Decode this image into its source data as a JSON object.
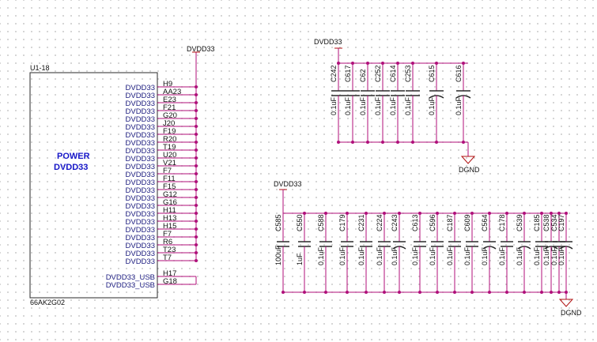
{
  "colors": {
    "wire": "#b00f7a",
    "component": "#2a2a2a",
    "power_symbol": "#b01010",
    "pin_text": "#1e1e82",
    "block_title": "#1616c8"
  },
  "u1": {
    "ref": "U1-18",
    "title_line1": "POWER",
    "title_line2": "DVDD33",
    "part": "66AK2G02",
    "net_top": "DVDD33",
    "pins": [
      {
        "name": "DVDD33",
        "num": "H9"
      },
      {
        "name": "DVDD33",
        "num": "AA23"
      },
      {
        "name": "DVDD33",
        "num": "E23"
      },
      {
        "name": "DVDD33",
        "num": "F21"
      },
      {
        "name": "DVDD33",
        "num": "G20"
      },
      {
        "name": "DVDD33",
        "num": "J20"
      },
      {
        "name": "DVDD33",
        "num": "F19"
      },
      {
        "name": "DVDD33",
        "num": "R20"
      },
      {
        "name": "DVDD33",
        "num": "T19"
      },
      {
        "name": "DVDD33",
        "num": "U20"
      },
      {
        "name": "DVDD33",
        "num": "V21"
      },
      {
        "name": "DVDD33",
        "num": "F7"
      },
      {
        "name": "DVDD33",
        "num": "F11"
      },
      {
        "name": "DVDD33",
        "num": "F15"
      },
      {
        "name": "DVDD33",
        "num": "G12"
      },
      {
        "name": "DVDD33",
        "num": "G16"
      },
      {
        "name": "DVDD33",
        "num": "H11"
      },
      {
        "name": "DVDD33",
        "num": "H13"
      },
      {
        "name": "DVDD33",
        "num": "H15"
      },
      {
        "name": "DVDD33",
        "num": "F7"
      },
      {
        "name": "DVDD33",
        "num": "R6"
      },
      {
        "name": "DVDD33",
        "num": "T23"
      },
      {
        "name": "DVDD33",
        "num": "T7"
      }
    ],
    "usb_pins": [
      {
        "name": "DVDD33_USB",
        "num": "H17"
      },
      {
        "name": "DVDD33_USB",
        "num": "G18"
      }
    ]
  },
  "group1": {
    "power": "DVDD33",
    "ground": "DGND",
    "caps": [
      {
        "ref": "C242",
        "value": "0.1uF",
        "polarized": false
      },
      {
        "ref": "C617",
        "value": "0.1uF",
        "polarized": false
      },
      {
        "ref": "C62",
        "value": "0.1uF",
        "polarized": false
      },
      {
        "ref": "C252",
        "value": "0.1uF",
        "polarized": false
      },
      {
        "ref": "C614",
        "value": "0.1uF",
        "polarized": false
      },
      {
        "ref": "C253",
        "value": "0.1uF",
        "polarized": false
      },
      {
        "ref": "C615",
        "value": "0.1uF",
        "polarized": true
      },
      {
        "ref": "C616",
        "value": "0.1uF",
        "polarized": true
      }
    ]
  },
  "group2": {
    "power": "DVDD33",
    "ground": "DGND",
    "caps": [
      {
        "ref": "C585",
        "value": "100uF",
        "polarized": false
      },
      {
        "ref": "C550",
        "value": "1uF",
        "polarized": false
      },
      {
        "ref": "C588",
        "value": "0.1uF",
        "polarized": false
      },
      {
        "ref": "C179",
        "value": "0.1uF",
        "polarized": false
      },
      {
        "ref": "C231",
        "value": "0.1uF",
        "polarized": false
      },
      {
        "ref": "C224",
        "value": "0.1uF",
        "polarized": false
      },
      {
        "ref": "C243",
        "value": "0.1uF",
        "polarized": true
      },
      {
        "ref": "C613",
        "value": "0.1uF",
        "polarized": false
      },
      {
        "ref": "C596",
        "value": "0.1uF",
        "polarized": false
      },
      {
        "ref": "C187",
        "value": "0.1uF",
        "polarized": false
      },
      {
        "ref": "C609",
        "value": "0.1uF",
        "polarized": false
      },
      {
        "ref": "C564",
        "value": "0.1uF",
        "polarized": true
      },
      {
        "ref": "C178",
        "value": "0.1uF",
        "polarized": false
      },
      {
        "ref": "C539",
        "value": "0.1uF",
        "polarized": true
      },
      {
        "ref": "C185",
        "value": "0.1uF",
        "polarized": false
      },
      {
        "ref": "C534",
        "value": "0.1uF",
        "polarized": false
      },
      {
        "ref": "C538",
        "value": "0.1uF",
        "polarized": true
      },
      {
        "ref": "C197",
        "value": "0.1uF",
        "polarized": true
      }
    ]
  }
}
